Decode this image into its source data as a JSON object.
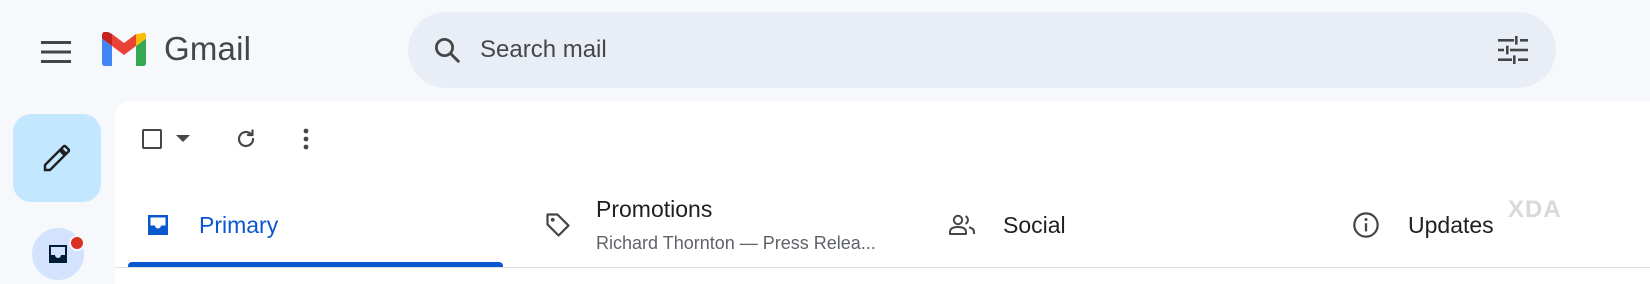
{
  "header": {
    "app_name": "Gmail",
    "menu_icon": "hamburger-menu-icon",
    "search": {
      "placeholder": "Search mail",
      "value": "",
      "icon": "search-icon",
      "filter_icon": "tune-icon"
    }
  },
  "rail": {
    "compose_icon": "pencil-icon",
    "inbox_icon": "inbox-icon",
    "has_unread_dot": true
  },
  "toolbar": {
    "select_icon": "checkbox-icon",
    "select_dropdown_icon": "caret-down-icon",
    "refresh_icon": "refresh-icon",
    "more_icon": "more-vert-icon"
  },
  "tabs": [
    {
      "label": "Primary",
      "icon": "inbox-icon",
      "active": true,
      "subtitle": ""
    },
    {
      "label": "Promotions",
      "icon": "tag-icon",
      "active": false,
      "subtitle": "Richard Thornton — Press Relea..."
    },
    {
      "label": "Social",
      "icon": "people-icon",
      "active": false,
      "subtitle": ""
    },
    {
      "label": "Updates",
      "icon": "info-icon",
      "active": false,
      "subtitle": ""
    }
  ],
  "watermark": "XDA",
  "colors": {
    "accent": "#0b57d0",
    "compose_bg": "#c2e7ff",
    "search_bg": "#e9eef6",
    "page_bg": "#f6f8fc",
    "unread_dot": "#d93025"
  }
}
